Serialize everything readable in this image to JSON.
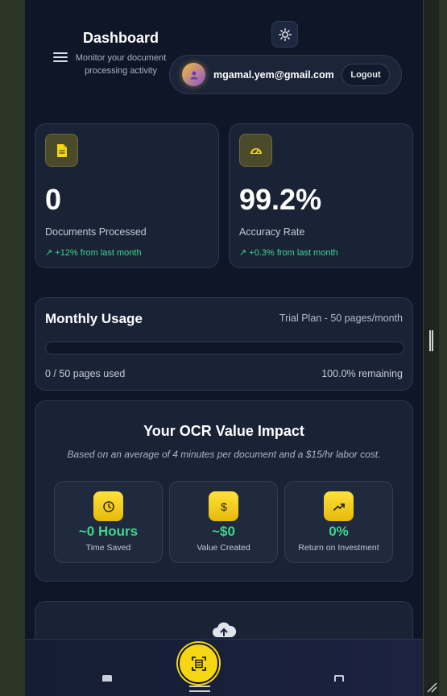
{
  "header": {
    "title": "Dashboard",
    "subtitle": "Monitor your document processing activity",
    "menu_icon": "hamburger-menu-icon",
    "theme_icon": "sun-icon"
  },
  "user": {
    "email": "mgamal.yem@gmail.com",
    "logout_label": "Logout",
    "avatar_icon": "user-icon"
  },
  "stats": [
    {
      "icon": "document-icon",
      "value": "0",
      "label": "Documents Processed",
      "change": "↗ +12% from last month"
    },
    {
      "icon": "gauge-icon",
      "value": "99.2%",
      "label": "Accuracy Rate",
      "change": "↗ +0.3% from last month"
    }
  ],
  "usage": {
    "title": "Monthly Usage",
    "plan": "Trial Plan - 50 pages/month",
    "used": "0 / 50 pages used",
    "remaining": "100.0% remaining",
    "progress_fraction": 0
  },
  "impact": {
    "title": "Your OCR Value Impact",
    "description": "Based on an average of 4 minutes per document and a $15/hr labor cost.",
    "metrics": [
      {
        "icon": "clock-icon",
        "value": "~0 Hours",
        "label": "Time Saved"
      },
      {
        "icon": "dollar-icon",
        "value": "~$0",
        "label": "Value Created"
      },
      {
        "icon": "trending-up-icon",
        "value": "0%",
        "label": "Return on Investment"
      }
    ]
  },
  "upload": {
    "icon": "cloud-upload-icon"
  },
  "bottom_nav": {
    "scan_icon": "scan-icon"
  },
  "colors": {
    "accent": "#f4d612",
    "positive": "#3dd68c",
    "background": "#0e1628",
    "card": "#1a2336"
  }
}
